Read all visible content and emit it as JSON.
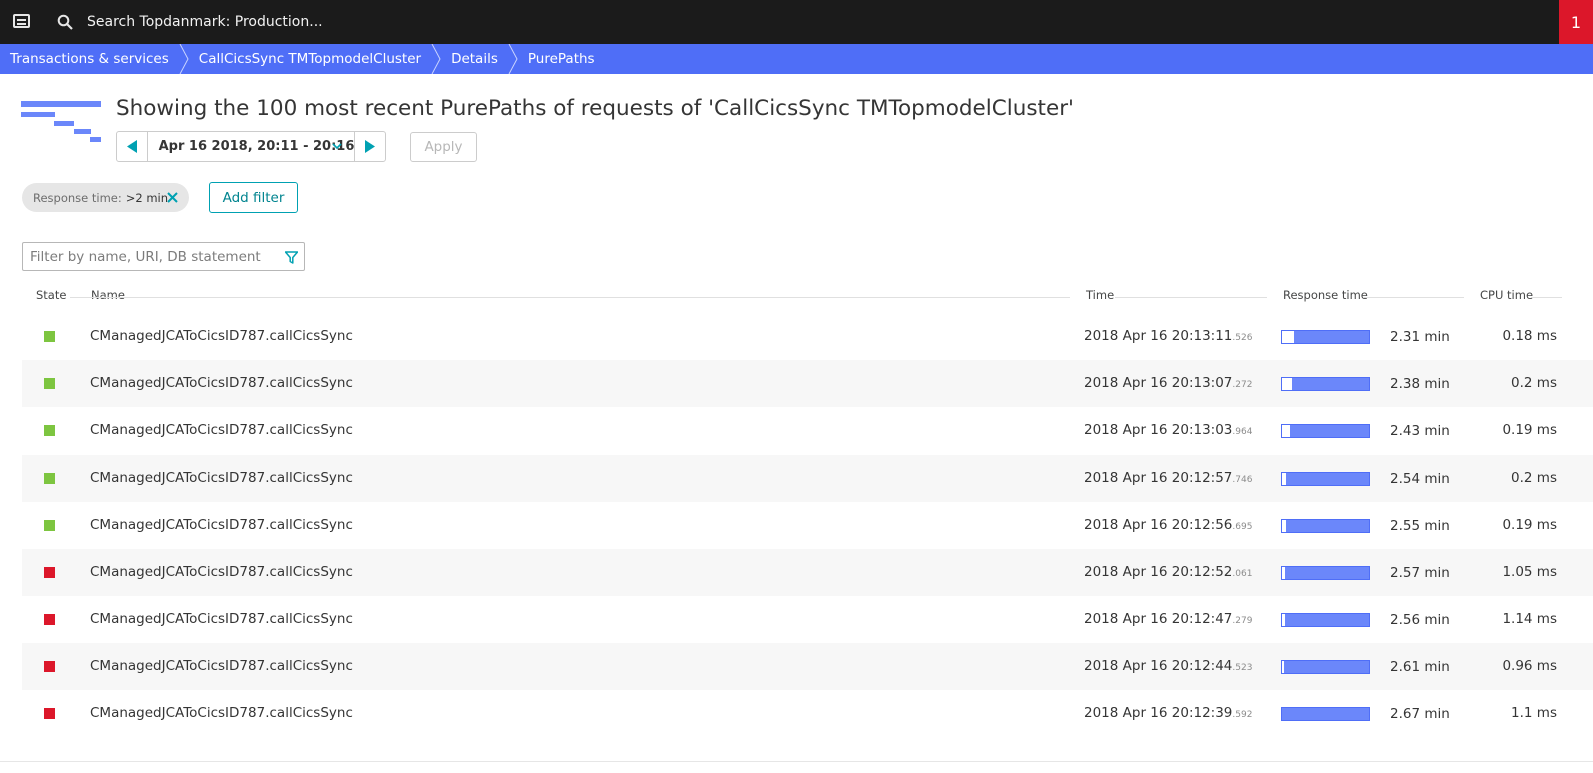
{
  "topbar": {
    "search_text": "Search Topdanmark: Production...",
    "problems_count": "1"
  },
  "breadcrumb": [
    {
      "label": "Transactions & services"
    },
    {
      "label": "CallCicsSync TMTopmodelCluster"
    },
    {
      "label": "Details"
    },
    {
      "label": "PurePaths"
    }
  ],
  "header": {
    "title": "Showing the 100 most recent PurePaths of requests of 'CallCicsSync TMTopmodelCluster'"
  },
  "timeframe": {
    "label": "Apr 16 2018, 20:11 - 20:16",
    "apply_label": "Apply"
  },
  "filters": {
    "chip_key": "Response time:",
    "chip_value": ">2 min",
    "add_filter_label": "Add filter",
    "search_placeholder": "Filter by name, URI, DB statement"
  },
  "table": {
    "columns": {
      "state": "State",
      "name": "Name",
      "time": "Time",
      "response_time": "Response time",
      "cpu_time": "CPU time"
    },
    "rows": [
      {
        "state": "success",
        "name": "CManagedJCAToCicsID787.callCicsSync",
        "time": "2018 Apr 16 20:13:11",
        "ms": ".526",
        "rt_fraction": 0.865,
        "response_time": "2.31 min",
        "cpu": "0.18 ms"
      },
      {
        "state": "success",
        "name": "CManagedJCAToCicsID787.callCicsSync",
        "time": "2018 Apr 16 20:13:07",
        "ms": ".272",
        "rt_fraction": 0.89,
        "response_time": "2.38 min",
        "cpu": "0.2 ms"
      },
      {
        "state": "success",
        "name": "CManagedJCAToCicsID787.callCicsSync",
        "time": "2018 Apr 16 20:13:03",
        "ms": ".964",
        "rt_fraction": 0.91,
        "response_time": "2.43 min",
        "cpu": "0.19 ms"
      },
      {
        "state": "success",
        "name": "CManagedJCAToCicsID787.callCicsSync",
        "time": "2018 Apr 16 20:12:57",
        "ms": ".746",
        "rt_fraction": 0.95,
        "response_time": "2.54 min",
        "cpu": "0.2 ms"
      },
      {
        "state": "success",
        "name": "CManagedJCAToCicsID787.callCicsSync",
        "time": "2018 Apr 16 20:12:56",
        "ms": ".695",
        "rt_fraction": 0.955,
        "response_time": "2.55 min",
        "cpu": "0.19 ms"
      },
      {
        "state": "failed",
        "name": "CManagedJCAToCicsID787.callCicsSync",
        "time": "2018 Apr 16 20:12:52",
        "ms": ".061",
        "rt_fraction": 0.96,
        "response_time": "2.57 min",
        "cpu": "1.05 ms"
      },
      {
        "state": "failed",
        "name": "CManagedJCAToCicsID787.callCicsSync",
        "time": "2018 Apr 16 20:12:47",
        "ms": ".279",
        "rt_fraction": 0.96,
        "response_time": "2.56 min",
        "cpu": "1.14 ms"
      },
      {
        "state": "failed",
        "name": "CManagedJCAToCicsID787.callCicsSync",
        "time": "2018 Apr 16 20:12:44",
        "ms": ".523",
        "rt_fraction": 0.975,
        "response_time": "2.61 min",
        "cpu": "0.96 ms"
      },
      {
        "state": "failed",
        "name": "CManagedJCAToCicsID787.callCicsSync",
        "time": "2018 Apr 16 20:12:39",
        "ms": ".592",
        "rt_fraction": 1.0,
        "response_time": "2.67 min",
        "cpu": "1.1 ms"
      }
    ]
  },
  "colors": {
    "topbar": "#1b1b1b",
    "breadcrumb": "#4f6ef7",
    "success": "#7dc540",
    "failed": "#dc172a",
    "accent": "#00a1b2",
    "bar_fill": "#6b87fa"
  }
}
